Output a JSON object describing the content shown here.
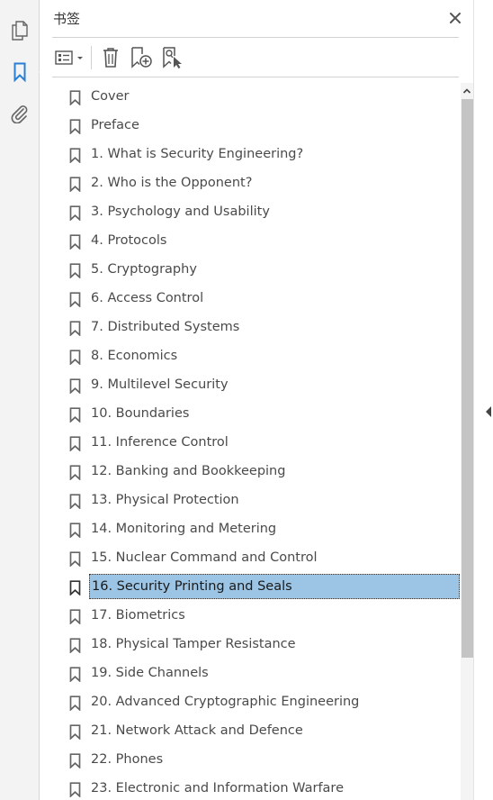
{
  "rail": {
    "items": [
      {
        "icon": "pages-icon",
        "active": false
      },
      {
        "icon": "bookmark-icon",
        "active": true
      },
      {
        "icon": "attachment-icon",
        "active": false
      }
    ]
  },
  "panel": {
    "title": "书签",
    "close_icon": "close-icon",
    "accent_color": "#2a7fd4",
    "selected_color": "#9cc4e4"
  },
  "toolbar": {
    "buttons": [
      {
        "icon": "options-list-icon"
      },
      {
        "icon": "delete-icon"
      },
      {
        "icon": "new-bookmark-icon"
      },
      {
        "icon": "find-bookmark-icon"
      }
    ]
  },
  "bookmarks": [
    {
      "label": "Cover"
    },
    {
      "label": "Preface"
    },
    {
      "label": "1. What is Security Engineering?"
    },
    {
      "label": "2. Who is the Opponent?"
    },
    {
      "label": "3. Psychology and Usability"
    },
    {
      "label": "4. Protocols"
    },
    {
      "label": "5. Cryptography"
    },
    {
      "label": "6. Access Control"
    },
    {
      "label": "7. Distributed Systems"
    },
    {
      "label": "8. Economics"
    },
    {
      "label": "9. Multilevel Security"
    },
    {
      "label": "10. Boundaries"
    },
    {
      "label": "11. Inference Control"
    },
    {
      "label": "12. Banking and Bookkeeping"
    },
    {
      "label": "13. Physical Protection"
    },
    {
      "label": "14. Monitoring and Metering"
    },
    {
      "label": "15. Nuclear Command and Control"
    },
    {
      "label": "16. Security Printing and Seals",
      "selected": true
    },
    {
      "label": "17. Biometrics"
    },
    {
      "label": "18. Physical Tamper Resistance"
    },
    {
      "label": "19. Side Channels"
    },
    {
      "label": "20. Advanced Cryptographic Engineering"
    },
    {
      "label": "21. Network Attack and Defence"
    },
    {
      "label": "22. Phones"
    },
    {
      "label": "23. Electronic and Information Warfare"
    }
  ]
}
